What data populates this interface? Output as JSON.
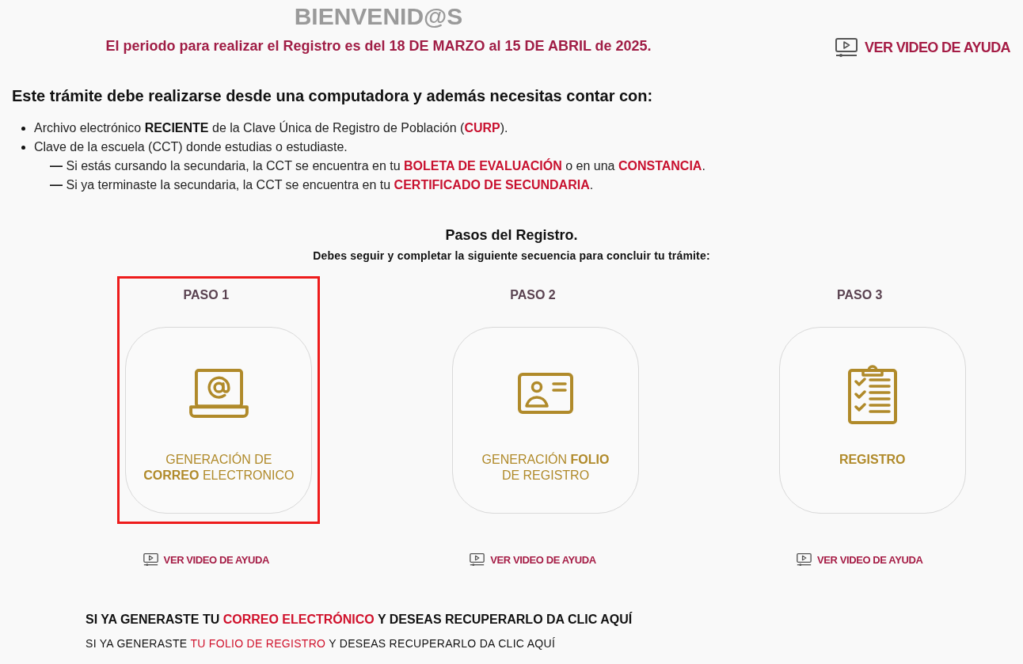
{
  "header": {
    "title": "BIENVENID@S",
    "period_notice": "El periodo para realizar el Registro es del 18 DE MARZO al 15 DE ABRIL de 2025.",
    "help_video_link": "VER VIDEO DE AYUDA"
  },
  "requirements": {
    "heading": "Este trámite debe realizarse desde una computadora y además necesitas contar con:",
    "items": [
      {
        "segments": [
          {
            "text": "Archivo electrónico ",
            "kind": "plain"
          },
          {
            "text": "RECIENTE",
            "kind": "bold"
          },
          {
            "text": " de la Clave Única de Registro de Población (",
            "kind": "plain"
          },
          {
            "text": "CURP",
            "kind": "highlight"
          },
          {
            "text": ").",
            "kind": "plain"
          }
        ]
      },
      {
        "segments": [
          {
            "text": "Clave de la escuela (CCT) donde estudias o estudiaste.",
            "kind": "plain"
          }
        ],
        "children": [
          {
            "segments": [
              {
                "text": "— ",
                "kind": "bold"
              },
              {
                "text": "Si estás cursando la secundaria, la CCT se encuentra en tu ",
                "kind": "plain"
              },
              {
                "text": "BOLETA DE EVALUACIÓN",
                "kind": "highlight"
              },
              {
                "text": " o en una ",
                "kind": "plain"
              },
              {
                "text": "CONSTANCIA",
                "kind": "highlight"
              },
              {
                "text": ".",
                "kind": "plain"
              }
            ]
          },
          {
            "segments": [
              {
                "text": "— ",
                "kind": "bold"
              },
              {
                "text": "Si ya terminaste la secundaria, la CCT se encuentra en tu ",
                "kind": "plain"
              },
              {
                "text": "CERTIFICADO DE SECUNDARIA",
                "kind": "highlight"
              },
              {
                "text": ".",
                "kind": "plain"
              }
            ]
          }
        ]
      }
    ]
  },
  "steps_section": {
    "title": "Pasos del Registro.",
    "subtitle": "Debes seguir y completar la siguiente secuencia para concluir tu trámite:",
    "steps": [
      {
        "label": "PASO 1",
        "kind": "email",
        "caption_lines": [
          "GENERACIÓN DE",
          "**CORREO** ELECTRONICO"
        ],
        "caption_bold": false,
        "selected": true,
        "help_video_link": "VER VIDEO DE AYUDA"
      },
      {
        "label": "PASO 2",
        "kind": "id-card",
        "caption_lines": [
          "GENERACIÓN **FOLIO**",
          "DE REGISTRO"
        ],
        "caption_bold": false,
        "selected": false,
        "help_video_link": "VER VIDEO DE AYUDA"
      },
      {
        "label": "PASO 3",
        "kind": "checklist",
        "caption_lines": [
          "REGISTRO"
        ],
        "caption_bold": true,
        "selected": false,
        "help_video_link": "VER VIDEO DE AYUDA"
      }
    ]
  },
  "recovery_links": [
    {
      "kind": "primary",
      "segments": [
        {
          "text": "SI YA GENERASTE TU ",
          "kind": "plain"
        },
        {
          "text": "CORREO ELECTRÓNICO",
          "kind": "highlight"
        },
        {
          "text": " Y DESEAS RECUPERARLO DA CLIC AQUÍ",
          "kind": "plain"
        }
      ]
    },
    {
      "kind": "secondary",
      "segments": [
        {
          "text": "SI YA GENERASTE ",
          "kind": "plain"
        },
        {
          "text": "TU FOLIO DE REGISTRO",
          "kind": "highlight"
        },
        {
          "text": " Y DESEAS RECUPERARLO DA CLIC AQUÍ",
          "kind": "plain"
        }
      ]
    }
  ]
}
